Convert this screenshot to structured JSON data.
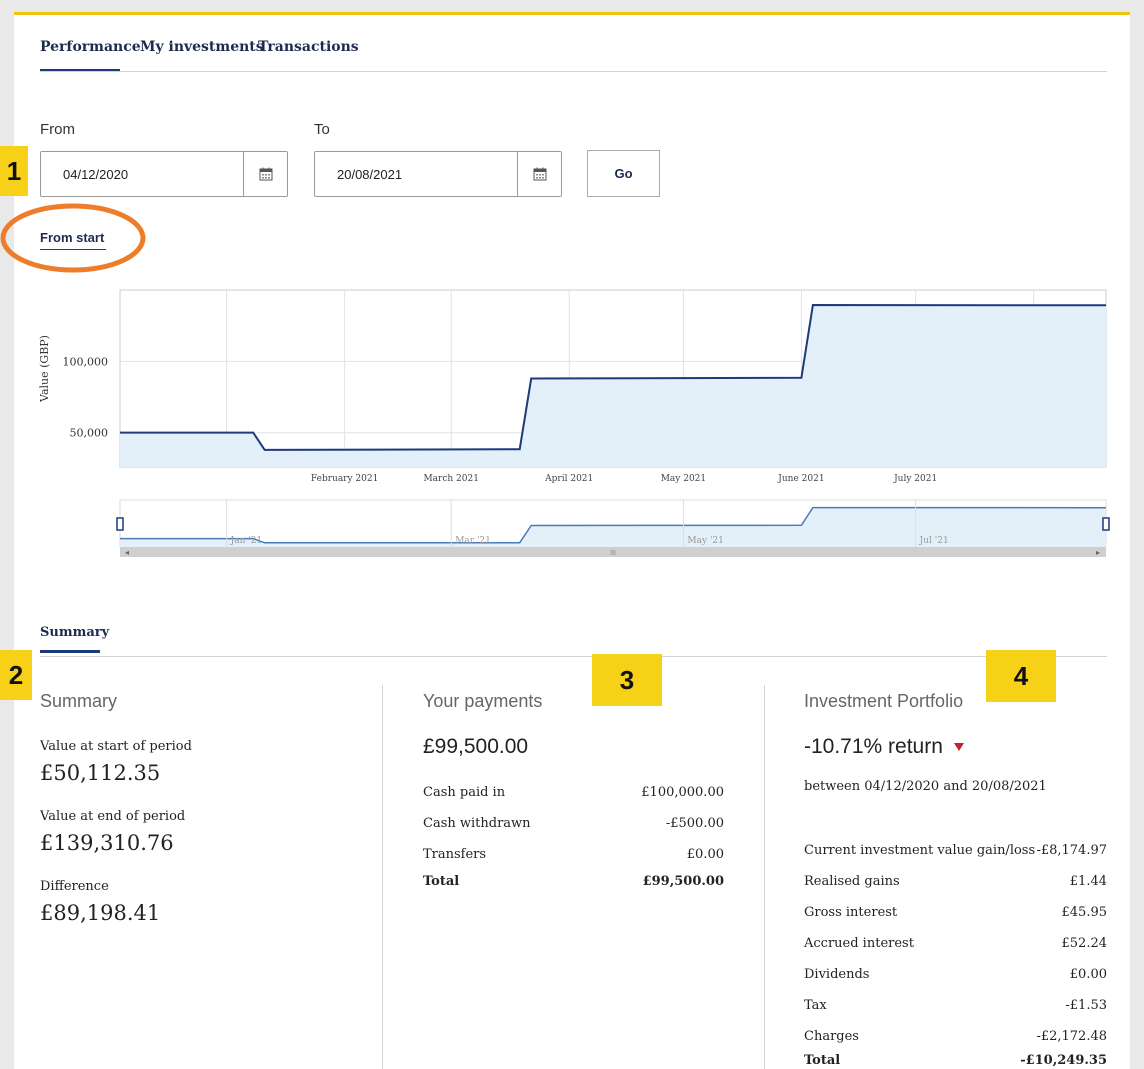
{
  "tabs": [
    {
      "label": "Performance"
    },
    {
      "label": "My investments"
    },
    {
      "label": "Transactions"
    }
  ],
  "date_filter": {
    "from_label": "From",
    "to_label": "To",
    "from_value": "04/12/2020",
    "to_value": "20/08/2021",
    "go_label": "Go",
    "from_start_label": "From start"
  },
  "badges": [
    "1",
    "2",
    "3",
    "4"
  ],
  "colors": {
    "accent_yellow": "#f7d117",
    "brand_navy": "#1d3a7a",
    "annotation_orange": "#ee7d2b",
    "down_red": "#c0242c",
    "chart_fill": "#e3f0f9"
  },
  "chart_data": {
    "type": "area",
    "ylabel": "Value (GBP)",
    "y_ticks": [
      "100,000",
      "50,000"
    ],
    "x_ticks": [
      "February 2021",
      "March 2021",
      "April 2021",
      "May 2021",
      "June 2021",
      "July 2021"
    ],
    "navigator_ticks": [
      "Jan '21",
      "Mar '21",
      "May '21",
      "Jul '21"
    ],
    "navigator_center_label": "III",
    "points": [
      {
        "x": "2020-12-04",
        "y": 50112
      },
      {
        "x": "2021-01-08",
        "y": 50112
      },
      {
        "x": "2021-01-11",
        "y": 38000
      },
      {
        "x": "2021-03-19",
        "y": 38500
      },
      {
        "x": "2021-03-22",
        "y": 88000
      },
      {
        "x": "2021-06-01",
        "y": 88500
      },
      {
        "x": "2021-06-04",
        "y": 139500
      },
      {
        "x": "2021-08-20",
        "y": 139310
      }
    ],
    "ylim": [
      26000,
      150000
    ]
  },
  "summary_tab": "Summary",
  "summary": {
    "title": "Summary",
    "start_label": "Value at start of period",
    "start_value": "£50,112.35",
    "end_label": "Value at end of period",
    "end_value": "£139,310.76",
    "diff_label": "Difference",
    "diff_value": "£89,198.41"
  },
  "payments": {
    "title": "Your payments",
    "total_big": "£99,500.00",
    "rows": [
      {
        "label": "Cash paid in",
        "value": "£100,000.00"
      },
      {
        "label": "Cash withdrawn",
        "value": "-£500.00"
      },
      {
        "label": "Transfers",
        "value": "£0.00"
      },
      {
        "label": "Total",
        "value": "£99,500.00"
      }
    ]
  },
  "portfolio": {
    "title": "Investment Portfolio",
    "return_text": "-10.71% return",
    "return_icon": "down-triangle",
    "between_text": "between 04/12/2020 and 20/08/2021",
    "rows": [
      {
        "label": "Current investment value gain/loss",
        "value": "-£8,174.97"
      },
      {
        "label": "Realised gains",
        "value": "£1.44"
      },
      {
        "label": "Gross interest",
        "value": "£45.95"
      },
      {
        "label": "Accrued interest",
        "value": "£52.24"
      },
      {
        "label": "Dividends",
        "value": "£0.00"
      },
      {
        "label": "Tax",
        "value": "-£1.53"
      },
      {
        "label": "Charges",
        "value": "-£2,172.48"
      },
      {
        "label": "Total",
        "value": "-£10,249.35"
      }
    ]
  }
}
